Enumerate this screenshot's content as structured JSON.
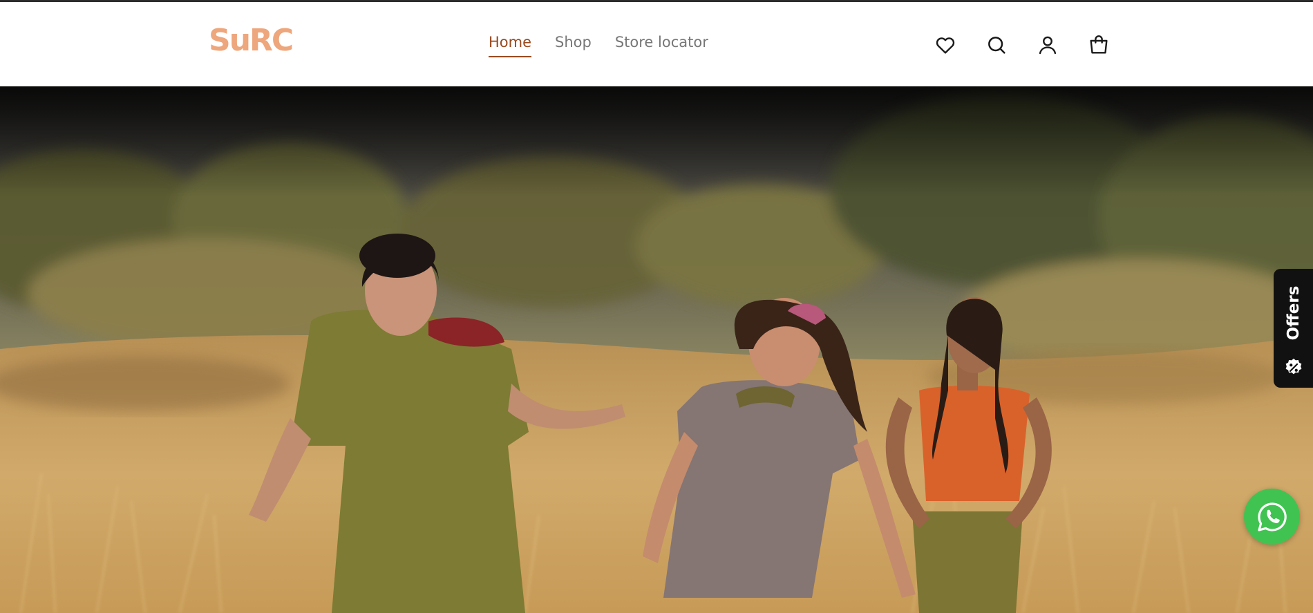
{
  "brand": {
    "logo_text": "SuRC",
    "logo_color": "#eea67c"
  },
  "nav": {
    "items": [
      {
        "label": "Home",
        "active": true
      },
      {
        "label": "Shop",
        "active": false
      },
      {
        "label": "Store locator",
        "active": false
      }
    ],
    "active_color": "#9a4a1f",
    "inactive_color": "#777777"
  },
  "header_icons": [
    "heart-icon",
    "search-icon",
    "user-icon",
    "shopping-bag-icon"
  ],
  "hero": {
    "description_icon": "hero-image",
    "palette": {
      "grass": "#c89e5c",
      "trees": "#6f6a38",
      "sky": "#3c3a36"
    }
  },
  "offers_tab": {
    "label": "Offers",
    "icon": "discount-badge-icon",
    "background": "#111111"
  },
  "whatsapp_button": {
    "icon": "whatsapp-icon",
    "color": "#40c351"
  }
}
